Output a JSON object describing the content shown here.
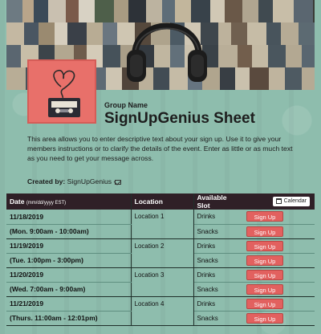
{
  "header": {
    "group_label": "Group Name",
    "title": "SignUpGenius Sheet",
    "description": "This area allows you to enter descriptive text about your sign up. Use it to give your members instructions or to clarify the details of the event. Enter as little or as much text as you need to get your message across.",
    "created_by_label": "Created by:",
    "created_by_name": "SignUpGenius"
  },
  "table": {
    "col_date": "Date",
    "col_date_hint": "(mm/dd/yyyy EST)",
    "col_location": "Location",
    "col_slot": "Available Slot",
    "calendar_label": "Calendar",
    "button_label": "Sign Up",
    "rows": [
      {
        "date": "11/18/2019",
        "time": "(Mon. 9:00am - 10:00am)",
        "location": "Location 1",
        "slot1": "Drinks",
        "slot2": "Snacks"
      },
      {
        "date": "11/19/2019",
        "time": "(Tue. 1:00pm - 3:00pm)",
        "location": "Location 2",
        "slot1": "Drinks",
        "slot2": "Snacks"
      },
      {
        "date": "11/20/2019",
        "time": "(Wed. 7:00am - 9:00am)",
        "location": "Location 3",
        "slot1": "Drinks",
        "slot2": "Snacks"
      },
      {
        "date": "11/21/2019",
        "time": "(Thurs. 11:00am - 12:01pm)",
        "location": "Location 4",
        "slot1": "Drinks",
        "slot2": "Snacks"
      }
    ]
  },
  "colors": {
    "background": "#8ebdad",
    "header_row": "#2f2027",
    "button": "#e2615f",
    "logo_bg": "#e8706a"
  }
}
